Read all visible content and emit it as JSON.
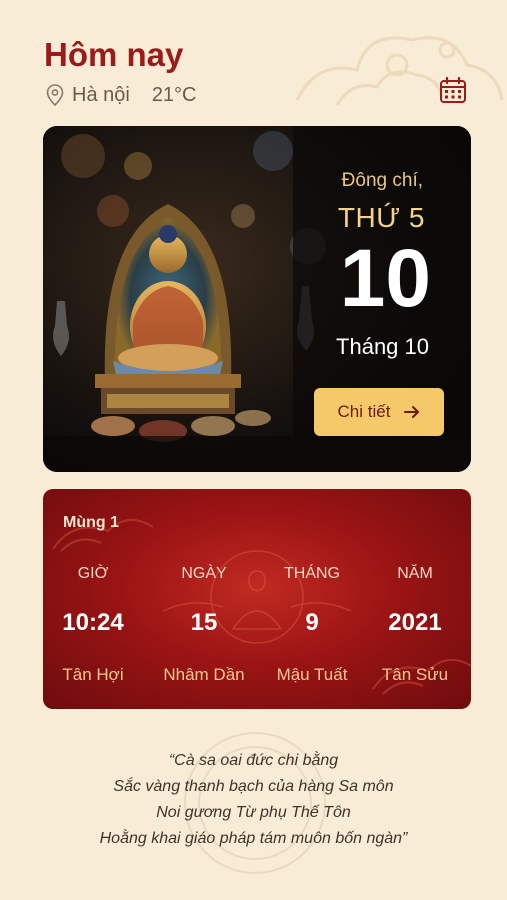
{
  "header": {
    "title": "Hôm nay",
    "location": "Hà nội",
    "temperature": "21°C"
  },
  "icons": {
    "location": "location-pin-icon",
    "calendar": "calendar-icon",
    "arrow": "arrow-right-icon"
  },
  "hero": {
    "solar_term": "Đông chí,",
    "weekday": "THỨ 5",
    "day": "10",
    "month": "Tháng 10",
    "detail_label": "Chi tiết"
  },
  "lunar": {
    "day_label": "Mùng 1",
    "columns": [
      {
        "label": "GIỜ",
        "value": "10:24",
        "can_chi": "Tân Hợi"
      },
      {
        "label": "NGÀY",
        "value": "15",
        "can_chi": "Nhâm Dần"
      },
      {
        "label": "THÁNG",
        "value": "9",
        "can_chi": "Mậu Tuất"
      },
      {
        "label": "NĂM",
        "value": "2021",
        "can_chi": "Tân Sửu"
      }
    ]
  },
  "quote": {
    "lines": [
      "“Cà sa oai đức chi bằng",
      "Sắc vàng thanh bạch của hàng Sa môn",
      "Noi gương Từ phụ Thế Tôn",
      "Hoằng khai giáo pháp tám muôn bốn ngàn”"
    ]
  },
  "colors": {
    "accent": "#9b1b1b",
    "background": "#f8ecd7",
    "button": "#f5c86a",
    "gold_text": "#f4d28a"
  }
}
